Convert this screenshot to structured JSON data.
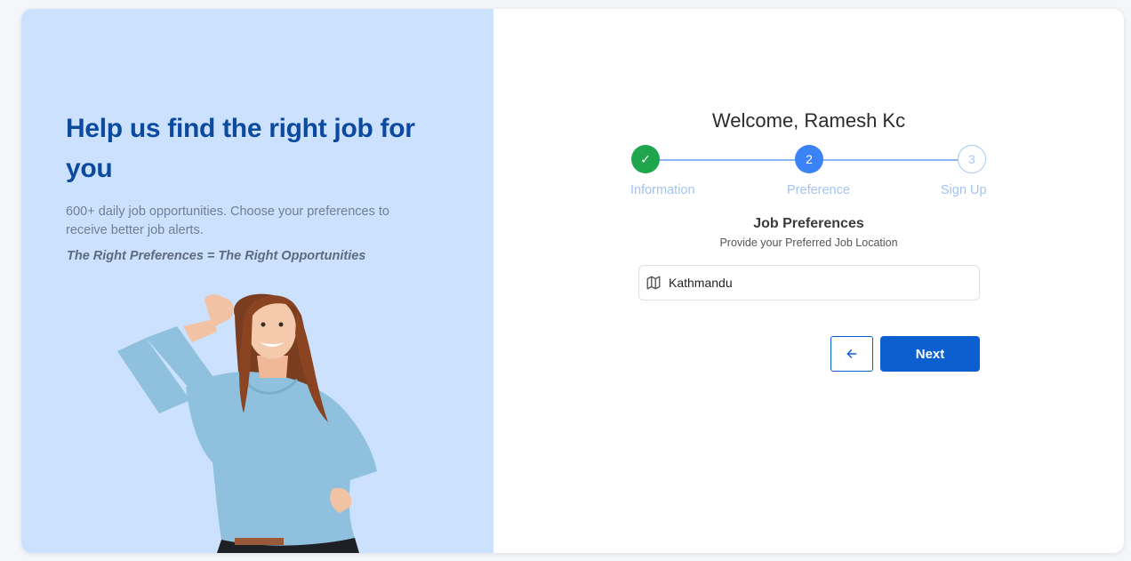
{
  "hero": {
    "title": "Help us find the right job for you",
    "subtitle": "600+ daily job opportunities. Choose your preferences to receive better job alerts.",
    "tagline": "The Right Preferences = The Right Opportunities"
  },
  "welcome": "Welcome, Ramesh Kc",
  "stepper": {
    "current_step": 2,
    "steps": [
      {
        "number": "✓",
        "label": "Information",
        "state": "complete"
      },
      {
        "number": "2",
        "label": "Preference",
        "state": "active"
      },
      {
        "number": "3",
        "label": "Sign Up",
        "state": "upcoming"
      }
    ]
  },
  "preferences": {
    "title": "Job Preferences",
    "subtitle": "Provide your Preferred Job Location",
    "location_value": "Kathmandu",
    "location_icon": "map-icon"
  },
  "actions": {
    "back_icon": "arrow-left-icon",
    "next_label": "Next"
  },
  "colors": {
    "accent": "#0b5fcf",
    "complete": "#1fa54b",
    "active": "#3b82f6",
    "hero_bg": "#cce1fd",
    "hero_title": "#0b4a9e"
  }
}
